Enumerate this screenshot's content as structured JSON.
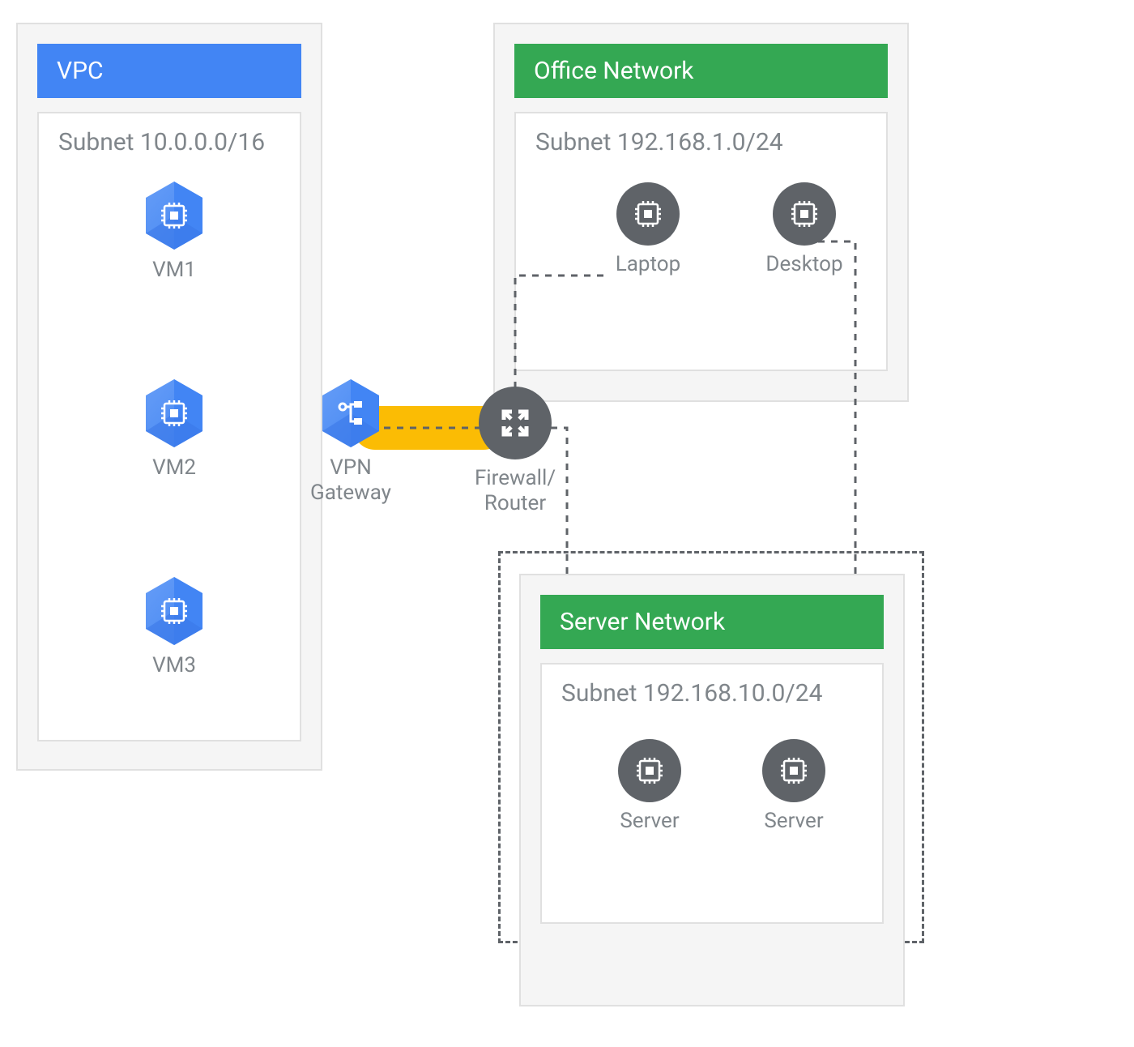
{
  "vpc": {
    "title": "VPC",
    "subnet": "Subnet 10.0.0.0/16",
    "vms": [
      "VM1",
      "VM2",
      "VM3"
    ],
    "gateway_label": "VPN\nGateway"
  },
  "firewall": {
    "label": "Firewall/\nRouter"
  },
  "office": {
    "title": "Office Network",
    "subnet": "Subnet 192.168.1.0/24",
    "devices": [
      "Laptop",
      "Desktop"
    ]
  },
  "server": {
    "title": "Server Network",
    "subnet": "Subnet 192.168.10.0/24",
    "devices": [
      "Server",
      "Server"
    ]
  }
}
